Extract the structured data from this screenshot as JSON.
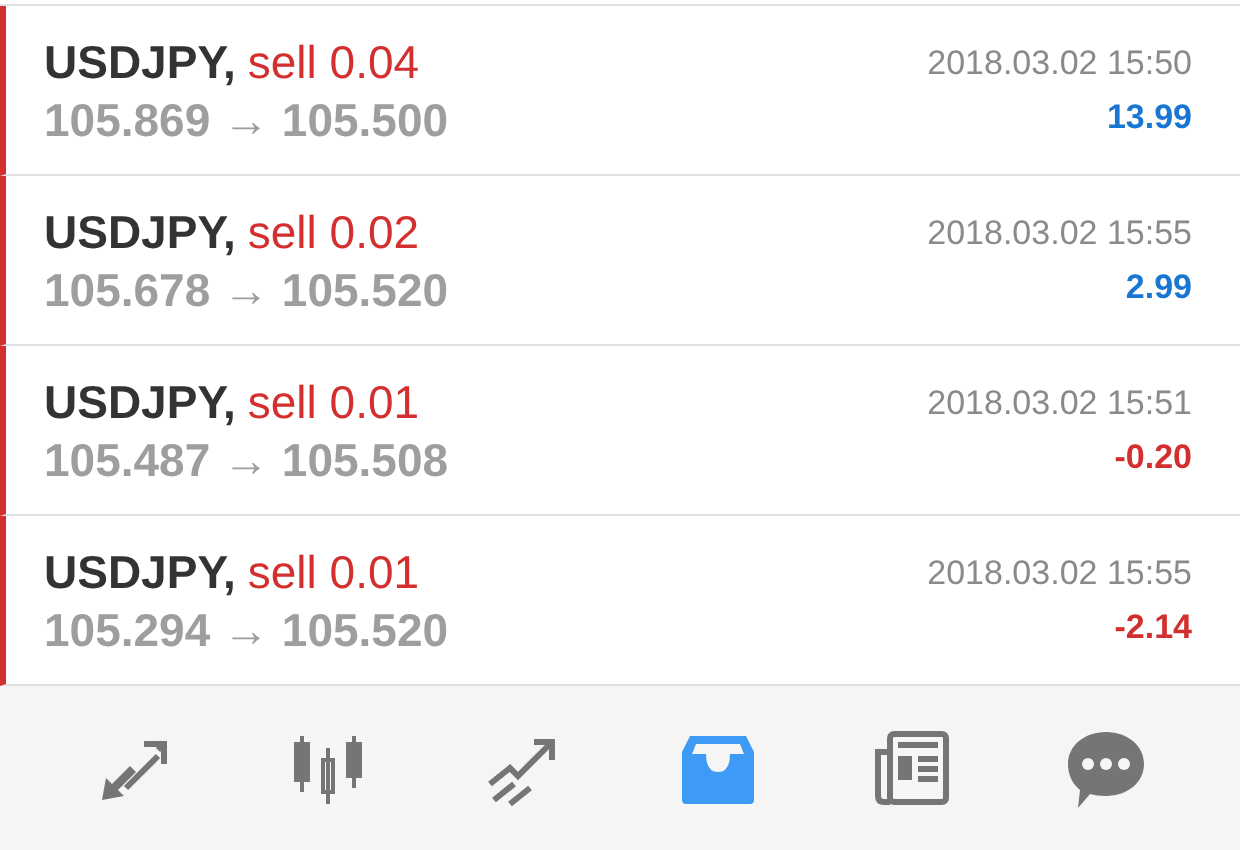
{
  "trades": [
    {
      "symbol": "USDJPY,",
      "action": "sell 0.04",
      "prices": "105.869 → 105.500",
      "time": "2018.03.02 15:50",
      "profit": "13.99",
      "color": "#1976d2"
    },
    {
      "symbol": "USDJPY,",
      "action": "sell 0.02",
      "prices": "105.678 → 105.520",
      "time": "2018.03.02 15:55",
      "profit": "2.99",
      "color": "#1976d2"
    },
    {
      "symbol": "USDJPY,",
      "action": "sell 0.01",
      "prices": "105.487 → 105.508",
      "time": "2018.03.02 15:51",
      "profit": "-0.20",
      "color": "#d32f2f"
    },
    {
      "symbol": "USDJPY,",
      "action": "sell 0.01",
      "prices": "105.294 → 105.520",
      "time": "2018.03.02 15:55",
      "profit": "-2.14",
      "color": "#d32f2f"
    }
  ],
  "nav": [
    {
      "kind": "quotes",
      "selected": false
    },
    {
      "kind": "chart",
      "selected": false
    },
    {
      "kind": "trade",
      "selected": false
    },
    {
      "kind": "history",
      "selected": true
    },
    {
      "kind": "news",
      "selected": false
    },
    {
      "kind": "messages",
      "selected": false
    }
  ]
}
